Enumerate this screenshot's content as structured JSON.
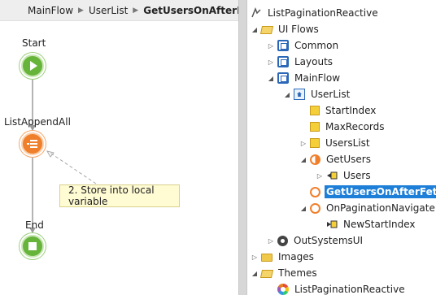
{
  "breadcrumb": {
    "items": [
      "MainFlow",
      "UserList",
      "GetUsersOnAfterFetch"
    ],
    "separator": "▶"
  },
  "flow": {
    "start_label": "Start",
    "append_label": "ListAppendAll",
    "end_label": "End",
    "comment": "2. Store into local variable"
  },
  "tree": {
    "root": "ListPaginationReactive",
    "ui_flows": "UI Flows",
    "common": "Common",
    "layouts": "Layouts",
    "mainflow": "MainFlow",
    "userlist": "UserList",
    "startindex": "StartIndex",
    "maxrecords": "MaxRecords",
    "userslist": "UsersList",
    "getusers": "GetUsers",
    "users": "Users",
    "getusersonafterfetch": "GetUsersOnAfterFetch",
    "onpaginationnavigate": "OnPaginationNavigate",
    "newstartindex": "NewStartIndex",
    "outsystemsui": "OutSystemsUI",
    "images": "Images",
    "themes": "Themes",
    "theme_item": "ListPaginationReactive"
  },
  "colors": {
    "start_end": "#67b43a",
    "action": "#f07f2c",
    "selection": "#1e7fd8",
    "comment_bg": "#fffbd3"
  }
}
